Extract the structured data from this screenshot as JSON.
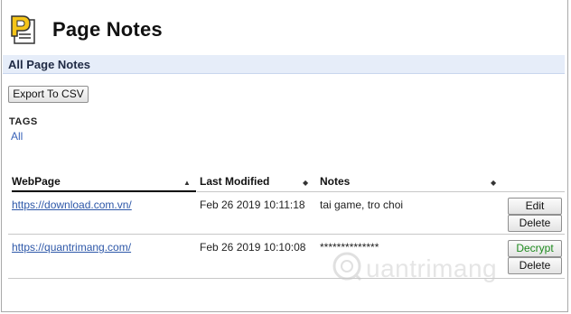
{
  "app": {
    "title": "Page Notes"
  },
  "section": {
    "title": "All Page Notes"
  },
  "toolbar": {
    "export_label": "Export To CSV"
  },
  "tags": {
    "label": "TAGS",
    "items": [
      "All"
    ]
  },
  "table": {
    "columns": [
      {
        "label": "WebPage",
        "sort": "▲"
      },
      {
        "label": "Last Modified",
        "sort": "◆"
      },
      {
        "label": "Notes",
        "sort": "◆"
      }
    ],
    "rows": [
      {
        "url": "https://download.com.vn/",
        "modified": "Feb 26 2019 10:11:18",
        "notes": "tai game, tro choi",
        "actions": [
          "Edit",
          "Delete"
        ]
      },
      {
        "url": "https://quantrimang.com/",
        "modified": "Feb 26 2019 10:10:08",
        "notes": "**************",
        "actions": [
          "Decrypt",
          "Delete"
        ]
      }
    ]
  },
  "watermark": {
    "text": "uantrimang"
  },
  "colors": {
    "accent": "#3a63b8",
    "decrypt": "#1e8a1e",
    "section_bg": "#e6edf9"
  }
}
